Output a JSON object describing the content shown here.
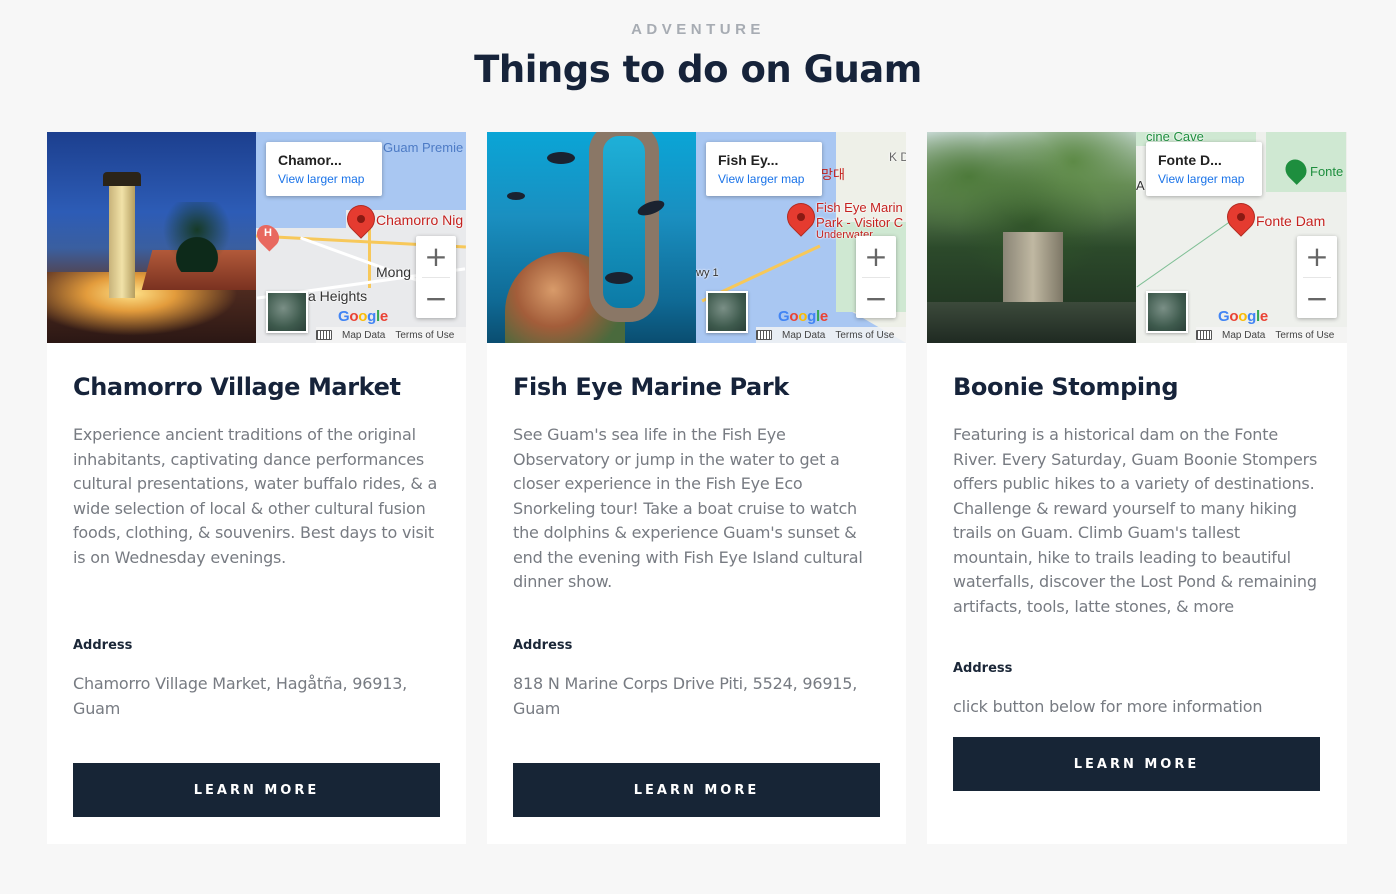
{
  "section": {
    "eyebrow": "ADVENTURE",
    "title": "Things to do on Guam"
  },
  "map_common": {
    "view_larger_map": "View larger map",
    "zoom_in": "+",
    "zoom_out": "−",
    "map_data": "Map Data",
    "terms": "Terms of Use",
    "google": "Google"
  },
  "cards": [
    {
      "title": "Chamorro Village Market",
      "description": "Experience ancient traditions of the original inhabitants, captivating dance performances cultural presentations, water buffalo rides, & a wide selection of local & other cultural fusion foods, clothing, & souvenirs. Best days to visit is on Wednesday evenings.",
      "address_label": "Address",
      "address": "Chamorro Village Market, Hagåtña, 96913, Guam",
      "button": "LEARN MORE",
      "map": {
        "infobox_place": "Chamor...",
        "pin_label": "Chamorro Nig",
        "labels": [
          "Guam Premie",
          "Mong",
          "a Heights"
        ]
      }
    },
    {
      "title": "Fish Eye Marine Park",
      "description": "See Guam's sea life in the Fish Eye Observatory or jump in the water to get a closer experience in the Fish Eye Eco Snorkeling tour! Take a boat cruise to watch the dolphins & experience Guam's sunset & end the evening with Fish Eye Island cultural dinner show.",
      "address_label": "Address",
      "address": "818 N Marine Corps Drive Piti, 5524, 96915, Guam",
      "button": "LEARN MORE",
      "map": {
        "infobox_place": "Fish Ey...",
        "pin_label": "Fish Eye Marin",
        "pin_label_2": "Park - Visitor C",
        "pin_label_3": "Underwater",
        "labels": [
          "망대",
          "K D",
          "wy 1"
        ]
      }
    },
    {
      "title": "Boonie Stomping",
      "description": "Featuring is a historical dam on the Fonte River. Every Saturday, Guam Boonie Stompers offers public hikes to a variety of destinations. Challenge & reward yourself to many hiking trails on Guam. Climb Guam's tallest mountain, hike to trails leading to beautiful waterfalls, discover the Lost Pond & remaining artifacts, tools, latte stones, & more",
      "address_label": "Address",
      "address": "click button below for more information",
      "button": "LEARN MORE",
      "map": {
        "infobox_place": "Fonte D...",
        "pin_label": "Fonte Dam",
        "labels": [
          "cine Cave",
          "Fonte",
          "A"
        ]
      }
    }
  ],
  "colors": {
    "background": "#f7f7f7",
    "card": "#ffffff",
    "button": "#172536",
    "title": "#16233a",
    "body_text": "#777b82",
    "eyebrow": "#a7acb3",
    "pin": "#e53b30",
    "link": "#1a73e8"
  },
  "icons": [
    "map-pin-icon",
    "keyboard-icon",
    "satellite-thumbnail-icon",
    "zoom-in-icon",
    "zoom-out-icon",
    "hospital-icon",
    "park-icon"
  ]
}
